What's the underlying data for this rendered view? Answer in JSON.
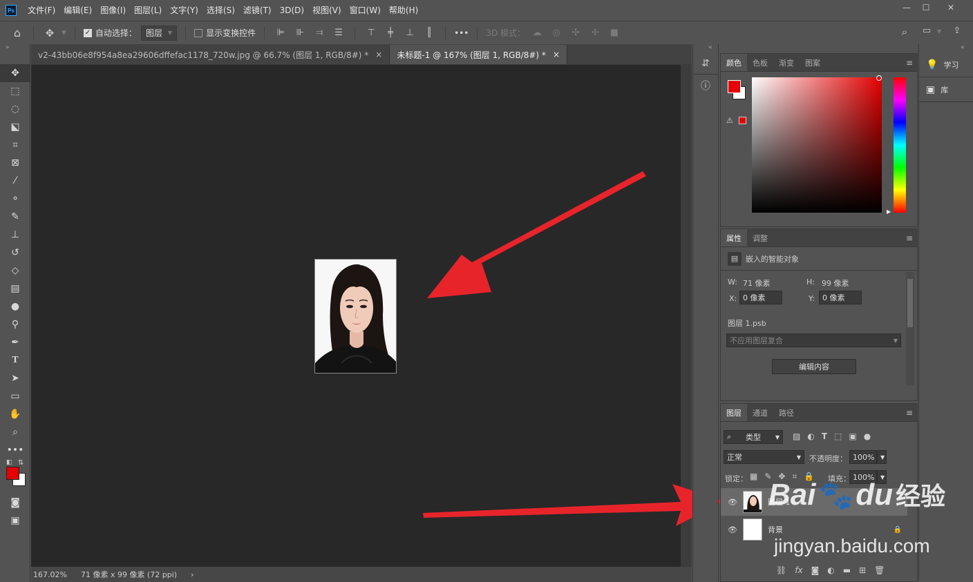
{
  "menubar": {
    "logo": "Ps",
    "items": [
      "文件(F)",
      "编辑(E)",
      "图像(I)",
      "图层(L)",
      "文字(Y)",
      "选择(S)",
      "滤镜(T)",
      "3D(D)",
      "视图(V)",
      "窗口(W)",
      "帮助(H)"
    ],
    "window_buttons": [
      "—",
      "☐",
      "✕"
    ]
  },
  "options": {
    "auto_select_label": "自动选择：",
    "auto_select_value": "图层",
    "show_transform_label": "显示变换控件",
    "more": "•••",
    "mode_3d_label": "3D 模式："
  },
  "tabs": [
    {
      "label": "v2-43bb06e8f954a8ea29606dffefac1178_720w.jpg @ 66.7% (图层 1, RGB/8#) *",
      "close": "×"
    },
    {
      "label": "未标题-1 @ 167% (图层 1, RGB/8#) *",
      "close": "×"
    }
  ],
  "status": {
    "zoom": "167.02%",
    "size": "71 像素 x 99 像素 (72 ppi)",
    "arrow": "›"
  },
  "color_panel": {
    "tabs": [
      "颜色",
      "色板",
      "渐变",
      "图案"
    ],
    "foreground": "#e40000",
    "background": "#ffffff"
  },
  "properties_panel": {
    "tabs": [
      "属性",
      "调整"
    ],
    "object_type": "嵌入的智能对象",
    "w_label": "W:",
    "w_value": "71 像素",
    "h_label": "H:",
    "h_value": "99 像素",
    "x_label": "X:",
    "x_value": "0 像素",
    "y_label": "Y:",
    "y_value": "0 像素",
    "file": "图层 1.psb",
    "comp_placeholder": "不应用图层复合",
    "edit_button": "编辑内容"
  },
  "layers_panel": {
    "tabs": [
      "图层",
      "通道",
      "路径"
    ],
    "filter_type": "类型",
    "blend_mode": "正常",
    "opacity_label": "不透明度：",
    "opacity_value": "100%",
    "lock_label": "锁定：",
    "fill_label": "填充：",
    "fill_value": "100%",
    "layers": [
      {
        "name": "图层 1",
        "visible": true,
        "selected": true
      },
      {
        "name": "背景",
        "visible": true,
        "selected": false
      }
    ],
    "footer_icons": [
      "link-icon",
      "fx-icon",
      "mask-icon",
      "adjustment-icon",
      "folder-icon",
      "new-layer-icon",
      "trash-icon"
    ],
    "fx": "fx"
  },
  "right_strip": {
    "items": [
      "学习",
      "库"
    ]
  },
  "watermark": {
    "brand": "Bai",
    "brand_tail": "du",
    "suffix": "经验",
    "url": "jingyan.baidu.com"
  },
  "colors": {
    "arrow": "#e8242b",
    "accent": "#31a8ff"
  }
}
